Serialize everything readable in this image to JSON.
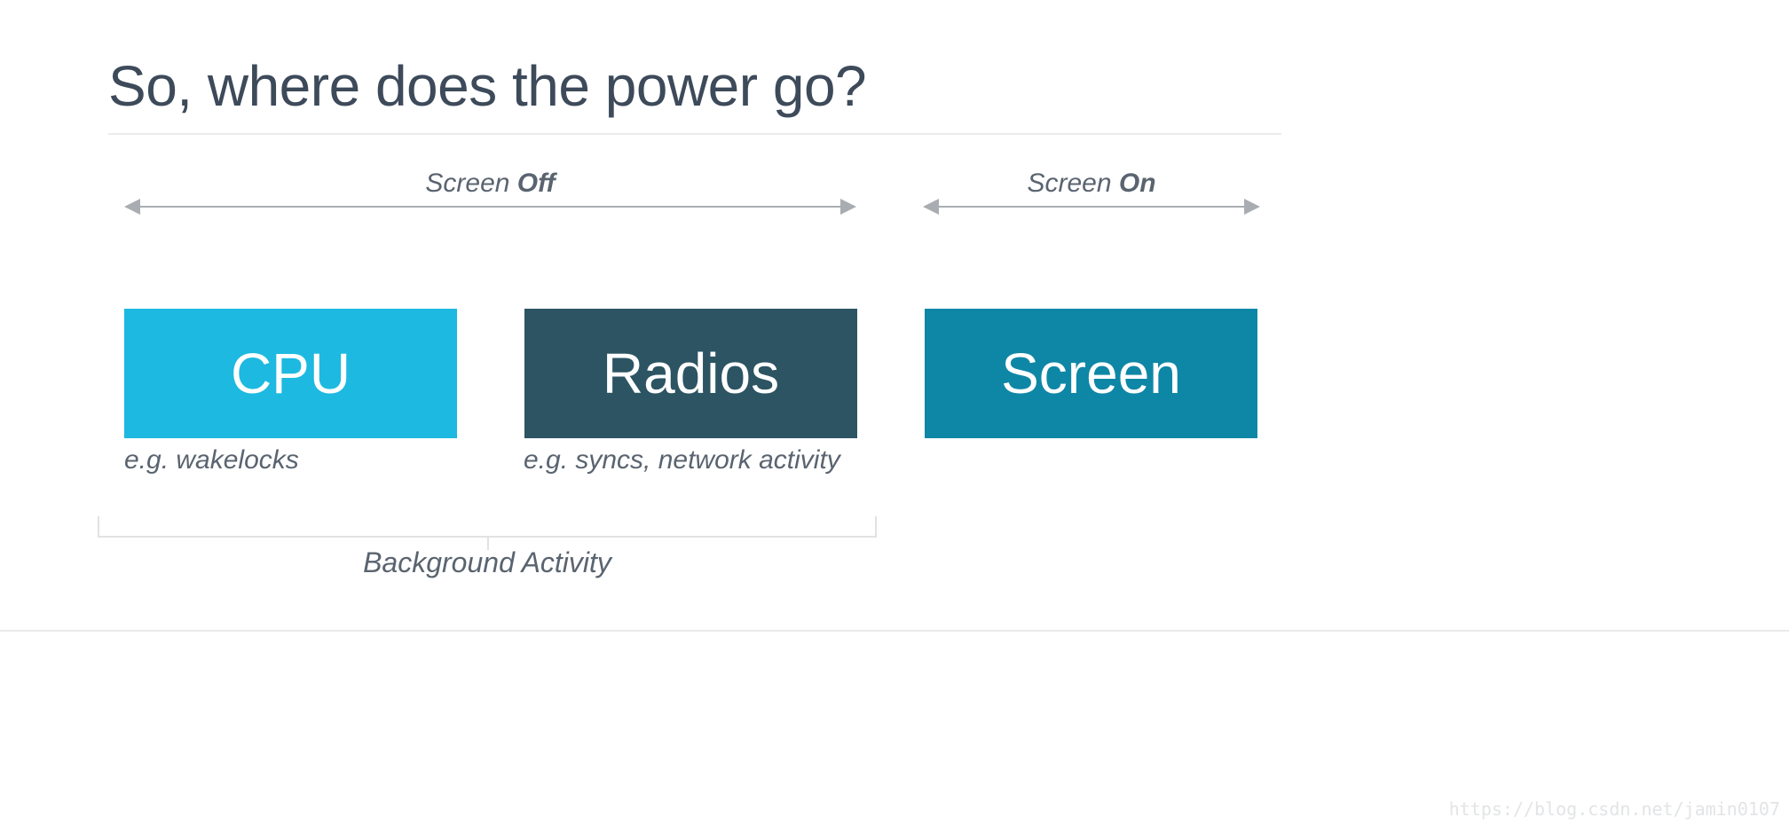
{
  "title": "So, where does the power go?",
  "arrows": {
    "off": {
      "prefix": "Screen ",
      "bold": "Off"
    },
    "on": {
      "prefix": "Screen ",
      "bold": "On"
    }
  },
  "boxes": {
    "cpu": {
      "label": "CPU",
      "caption": "e.g. wakelocks"
    },
    "radios": {
      "label": "Radios",
      "caption": "e.g. syncs,  network activity"
    },
    "screen": {
      "label": "Screen"
    }
  },
  "bracket_label": "Background Activity",
  "watermark": "https://blog.csdn.net/jamin0107",
  "colors": {
    "cpu": "#1db9e0",
    "radios": "#2c5463",
    "screen": "#0e87a6",
    "text": "#3c4858"
  }
}
